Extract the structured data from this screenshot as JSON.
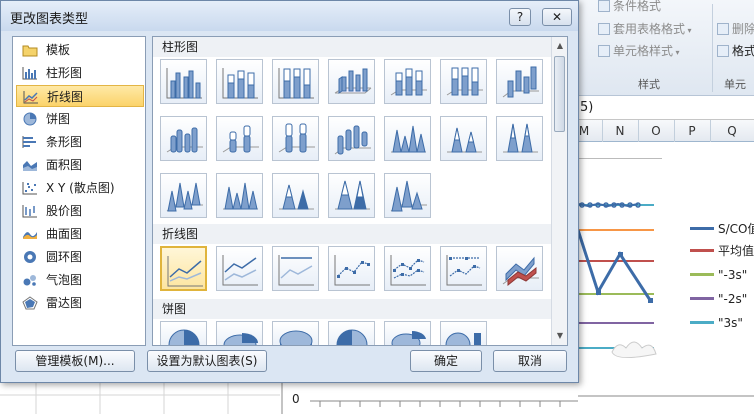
{
  "dialog": {
    "title": "更改图表类型",
    "help_label": "?",
    "close_label": "✕"
  },
  "categories": [
    {
      "label": "模板",
      "icon": "folder-icon"
    },
    {
      "label": "柱形图",
      "icon": "column-chart-icon"
    },
    {
      "label": "折线图",
      "icon": "line-chart-icon",
      "selected": true
    },
    {
      "label": "饼图",
      "icon": "pie-chart-icon"
    },
    {
      "label": "条形图",
      "icon": "bar-chart-icon"
    },
    {
      "label": "面积图",
      "icon": "area-chart-icon"
    },
    {
      "label": "X Y (散点图)",
      "icon": "scatter-chart-icon"
    },
    {
      "label": "股价图",
      "icon": "stock-chart-icon"
    },
    {
      "label": "曲面图",
      "icon": "surface-chart-icon"
    },
    {
      "label": "圆环图",
      "icon": "doughnut-chart-icon"
    },
    {
      "label": "气泡图",
      "icon": "bubble-chart-icon"
    },
    {
      "label": "雷达图",
      "icon": "radar-chart-icon"
    }
  ],
  "gallery": {
    "column_header": "柱形图",
    "line_header": "折线图",
    "pie_header": "饼图"
  },
  "buttons": {
    "manage_templates": "管理模板(M)...",
    "set_default": "设置为默认图表(S)",
    "ok": "确定",
    "cancel": "取消"
  },
  "background": {
    "ribbon": {
      "conditional_format": "条件格式",
      "table_format": "套用表格格式",
      "cell_styles": "单元格样式",
      "styles_group": "样式",
      "delete_label": "删除",
      "format_label": "格式",
      "cells_group": "单元"
    },
    "formula_fragment": "5)",
    "columns": [
      "M",
      "N",
      "O",
      "P",
      "Q"
    ],
    "legend": [
      {
        "label": "S/CO值",
        "color": "#3d6ca8"
      },
      {
        "label": "平均值",
        "color": "#c0504d"
      },
      {
        "label": "\"-3s\"",
        "color": "#9bbb59"
      },
      {
        "label": "\"-2s\"",
        "color": "#8064a2"
      },
      {
        "label": "\"3s\"",
        "color": "#4bacc6"
      }
    ],
    "axis_zero": "0"
  }
}
